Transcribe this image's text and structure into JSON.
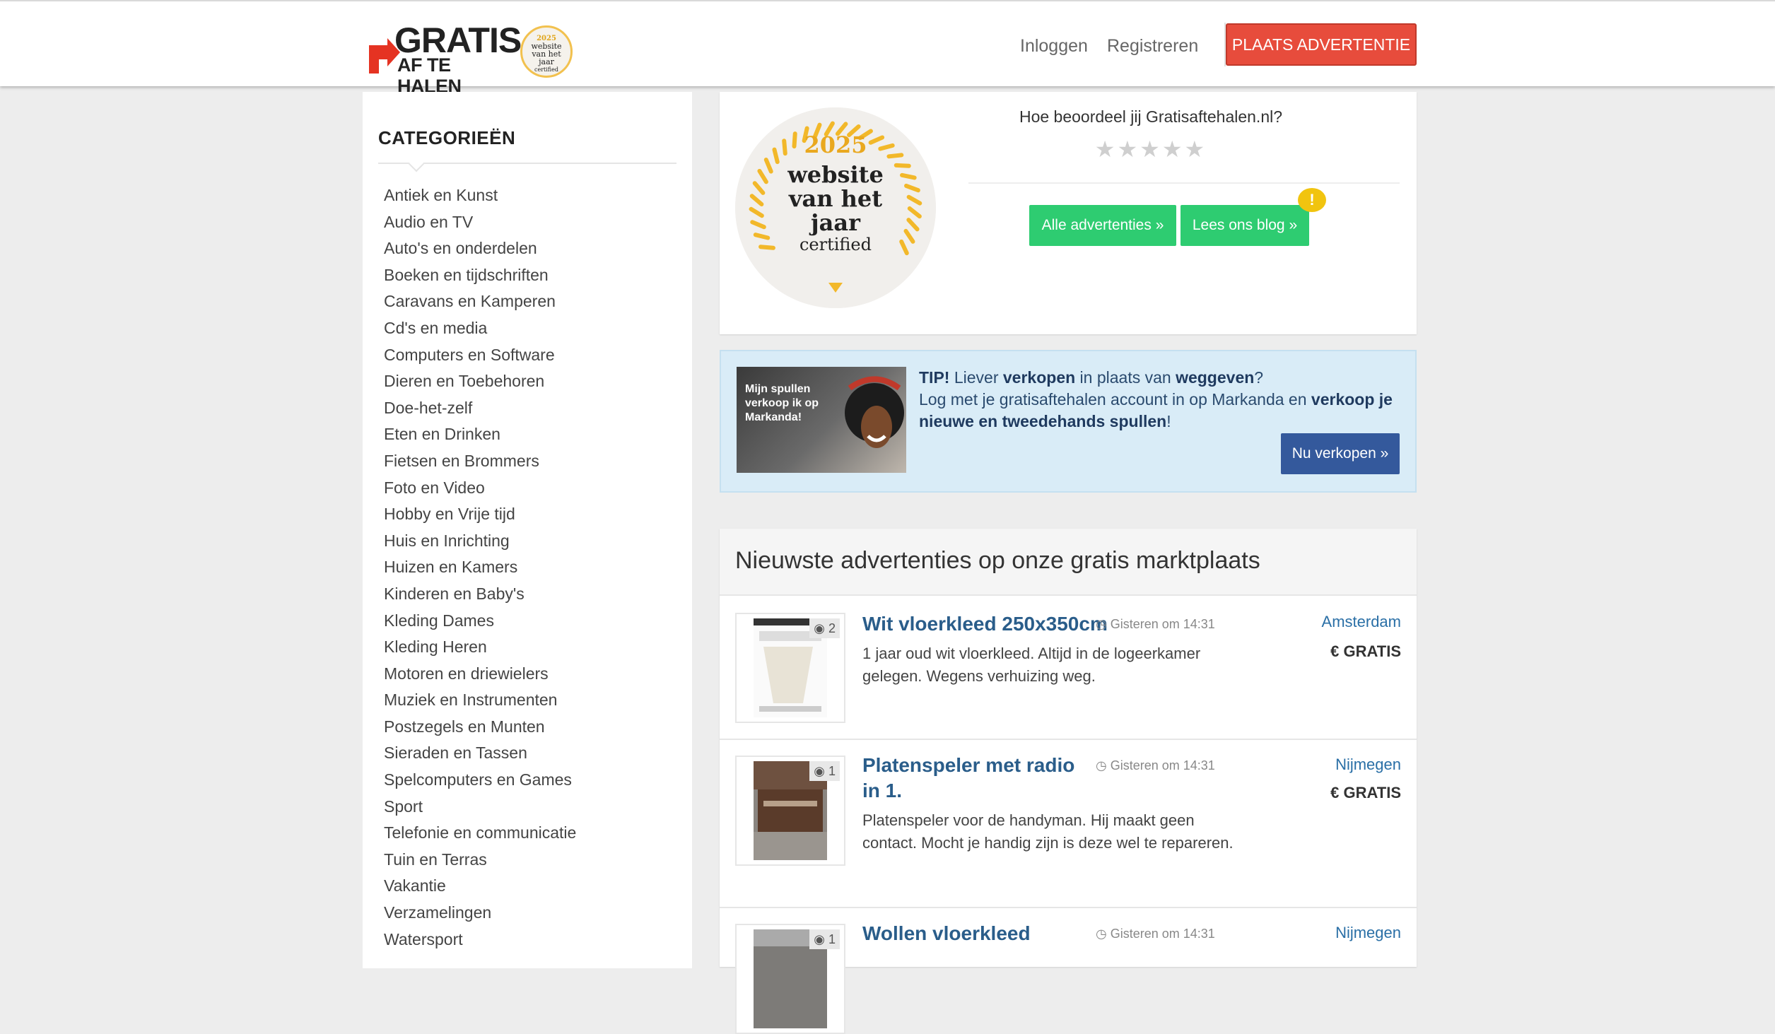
{
  "header": {
    "logo_line1": "GRATIS",
    "logo_line2": "AF TE HALEN",
    "badge_year": "2025",
    "badge_l1": "website",
    "badge_l2": "van het",
    "badge_l3": "jaar",
    "badge_l4": "certified",
    "login": "Inloggen",
    "register": "Registreren",
    "place_ad": "PLAATS ADVERTENTIE"
  },
  "sidebar": {
    "title": "CATEGORIEËN",
    "items": [
      "Antiek en Kunst",
      "Audio en TV",
      "Auto's en onderdelen",
      "Boeken en tijdschriften",
      "Caravans en Kamperen",
      "Cd's en media",
      "Computers en Software",
      "Dieren en Toebehoren",
      "Doe-het-zelf",
      "Eten en Drinken",
      "Fietsen en Brommers",
      "Foto en Video",
      "Hobby en Vrije tijd",
      "Huis en Inrichting",
      "Huizen en Kamers",
      "Kinderen en Baby's",
      "Kleding Dames",
      "Kleding Heren",
      "Motoren en driewielers",
      "Muziek en Instrumenten",
      "Postzegels en Munten",
      "Sieraden en Tassen",
      "Spelcomputers en Games",
      "Sport",
      "Telefonie en communicatie",
      "Tuin en Terras",
      "Vakantie",
      "Verzamelingen",
      "Watersport"
    ]
  },
  "rating": {
    "question": "Hoe beoordeel jij Gratisaftehalen.nl?",
    "stars": "★★★★★",
    "btn_all": "Alle advertenties »",
    "btn_blog": "Lees ons blog »",
    "blog_badge": "!",
    "badge_year": "2025",
    "badge_l1": "website",
    "badge_l2": "van het",
    "badge_l3": "jaar",
    "badge_l4": "certified"
  },
  "tip": {
    "image_text": "Mijn spullen verkoop ik op Markanda!",
    "tip_label": "TIP!",
    "t1": " Liever ",
    "t2": "verkopen",
    "t3": " in plaats van ",
    "t4": "weggeven",
    "t5": "?",
    "l1": "Log met je gratisaftehalen account in op Markanda en ",
    "l2": "verkoop je nieuwe en tweedehands spullen",
    "l3": "!",
    "button": "Nu verkopen »"
  },
  "listings": {
    "title": "Nieuwste advertenties op onze gratis marktplaats",
    "items": [
      {
        "title": "Wit vloerkleed 250x350cm",
        "time": "Gisteren om 14:31",
        "desc": "1 jaar oud wit vloerkleed. Altijd in de logeerkamer gelegen. Wegens verhuizing weg.",
        "city": "Amsterdam",
        "price": "€ GRATIS",
        "photos": "2"
      },
      {
        "title": "Platenspeler met radio in 1.",
        "time": "Gisteren om 14:31",
        "desc": "Platenspeler voor de handyman. Hij maakt geen contact. Mocht je handig zijn is deze wel te repareren.",
        "city": "Nijmegen",
        "price": "€ GRATIS",
        "photos": "1"
      },
      {
        "title": "Wollen vloerkleed",
        "time": "Gisteren om 14:31",
        "desc": "",
        "city": "Nijmegen",
        "price": "",
        "photos": "1"
      }
    ]
  }
}
